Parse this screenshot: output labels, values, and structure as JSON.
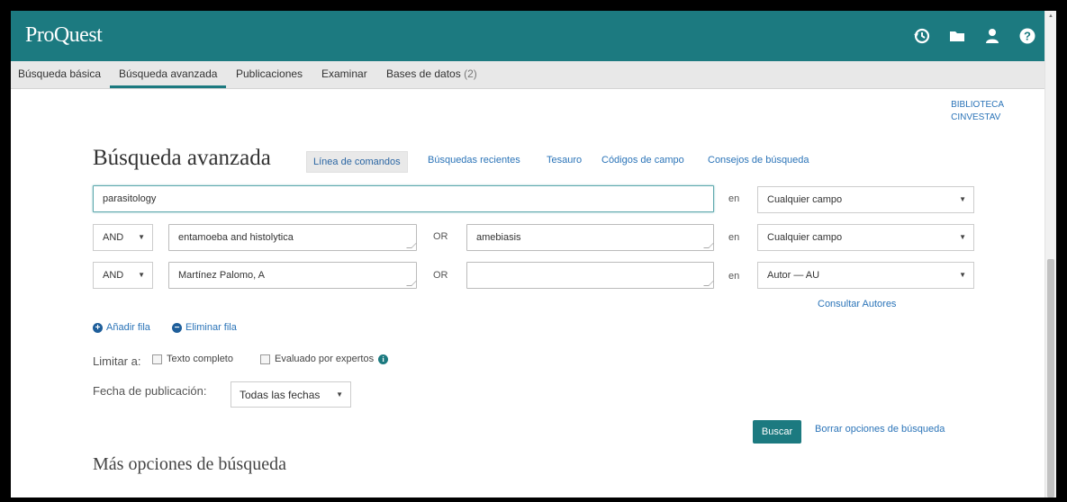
{
  "app": {
    "logo": "ProQuest"
  },
  "top_icons": [
    "history-icon",
    "folder-icon",
    "user-icon",
    "help-icon"
  ],
  "nav": {
    "tabs": [
      {
        "label": "Búsqueda básica"
      },
      {
        "label": "Búsqueda avanzada",
        "active": true
      },
      {
        "label": "Publicaciones"
      },
      {
        "label": "Examinar"
      },
      {
        "label": "Bases de datos",
        "count": "(2)"
      }
    ]
  },
  "library": {
    "line1": "BIBLIOTECA",
    "line2": "CINVESTAV"
  },
  "main": {
    "title": "Búsqueda avanzada",
    "command_line_button": "Línea de comandos",
    "links": [
      "Búsquedas recientes",
      "Tesauro",
      "Códigos de campo",
      "Consejos de búsqueda"
    ]
  },
  "rows": [
    {
      "value": "parasitology",
      "en": "en",
      "field": "Cualquier campo"
    },
    {
      "operator": "AND",
      "value": "entamoeba and histolytica",
      "or": "OR",
      "value2": "amebiasis",
      "en": "en",
      "field": "Cualquier campo"
    },
    {
      "operator": "AND",
      "value": "Martínez Palomo, A",
      "or": "OR",
      "value2": "",
      "en": "en",
      "field": "Autor — AU"
    }
  ],
  "consult_authors": "Consultar Autores",
  "row_actions": {
    "add": "Añadir fila",
    "remove": "Eliminar fila"
  },
  "limit": {
    "label": "Limitar a:",
    "full_text": {
      "label": "Texto completo",
      "checked": false
    },
    "peer_reviewed": {
      "label": "Evaluado por expertos",
      "checked": false
    }
  },
  "date": {
    "label": "Fecha de publicación:",
    "selected": "Todas las fechas"
  },
  "actions": {
    "search": "Buscar",
    "clear": "Borrar opciones de búsqueda"
  },
  "more_options": "Más opciones de búsqueda",
  "colors": {
    "brand": "#1c7a80",
    "link": "#2b74b8"
  }
}
